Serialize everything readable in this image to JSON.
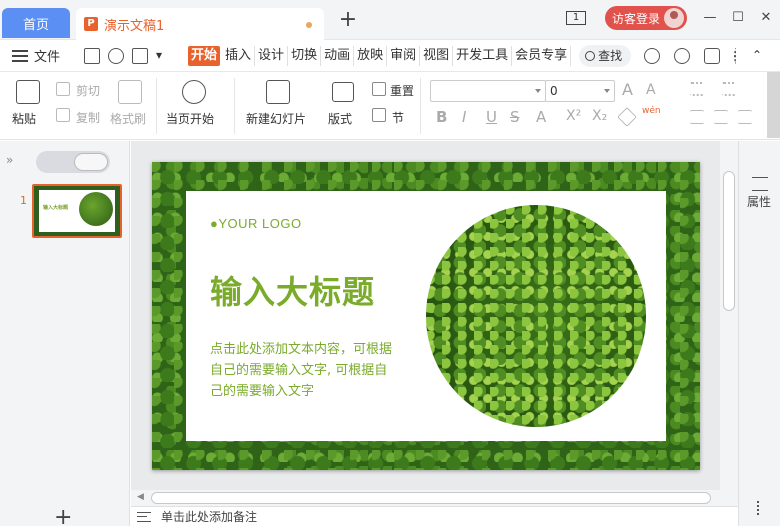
{
  "titlebar": {
    "home_tab": "首页",
    "doc_icon_letter": "P",
    "doc_tab": "演示文稿1",
    "add_tab": "+",
    "window_count": "1",
    "visitor_login": "访客登录",
    "minimize": "—",
    "maximize": "☐",
    "close": "✕"
  },
  "menubar": {
    "file": "文件",
    "tabs": [
      "开始",
      "插入",
      "设计",
      "切换",
      "动画",
      "放映",
      "审阅",
      "视图",
      "开发工具",
      "会员专享"
    ],
    "active_tab": "开始",
    "search": "查找"
  },
  "ribbon": {
    "paste": "粘贴",
    "cut": "剪切",
    "copy": "复制",
    "format_painter": "格式刷",
    "play_current": "当页开始",
    "new_slide": "新建幻灯片",
    "layout": "版式",
    "reset": "重置",
    "section": "节",
    "font_name": "",
    "font_size": "0",
    "bold": "B",
    "italic": "I",
    "underline": "U",
    "strike": "S",
    "font_color": "A",
    "superscript": "X²",
    "subscript": "X₂",
    "pinyin": "wén"
  },
  "left_pane": {
    "collapse": "»",
    "slide_number": "1",
    "thumb_title": "输入大标题",
    "add": "+"
  },
  "slide": {
    "logo": "●YOUR LOGO",
    "title": "输入大标题",
    "body": "点击此处添加文本内容，可根据自己的需要输入文字, 可根据自己的需要输入文字"
  },
  "notes": {
    "placeholder": "单击此处添加备注"
  },
  "right_pane": {
    "properties": "属性"
  },
  "colors": {
    "accent": "#e8622e",
    "home_tab": "#5b8ff4",
    "visitor": "#e0524b",
    "slide_text": "#7aab2b"
  }
}
